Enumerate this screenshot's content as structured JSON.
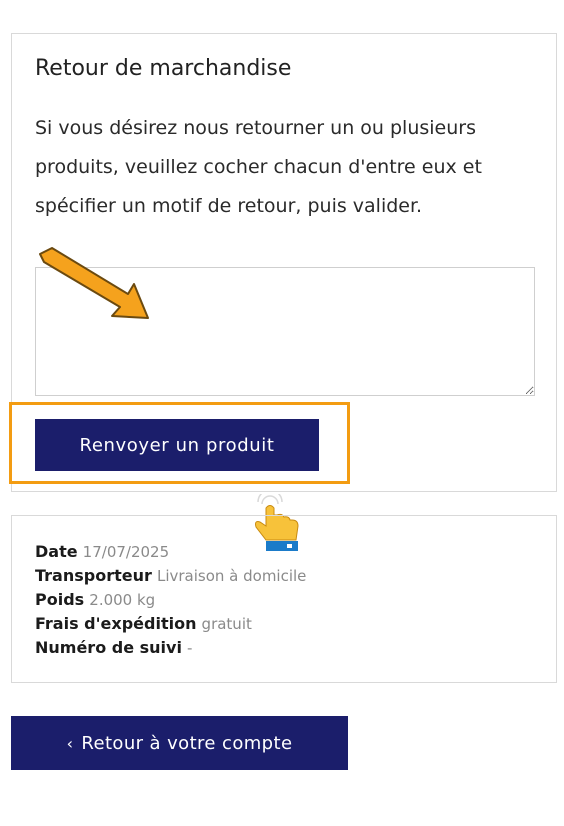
{
  "return_section": {
    "title": "Retour de marchandise",
    "description": "Si vous désirez nous retourner un ou plusieurs produits, veuillez cocher chacun d'entre eux et spécifier un motif de retour, puis valider.",
    "reason_textarea": {
      "value": "",
      "placeholder": ""
    },
    "submit_label": "Renvoyer un produit"
  },
  "annotations": {
    "arrow_icon": "arrow-pointing-down-right",
    "hand_icon": "pointing-hand-click",
    "highlight_color": "#f39c12"
  },
  "shipping_details": {
    "items": [
      {
        "label": "Date",
        "value": "17/07/2025"
      },
      {
        "label": "Transporteur",
        "value": "Livraison à domicile"
      },
      {
        "label": "Poids",
        "value": "2.000 kg"
      },
      {
        "label": "Frais d'expédition",
        "value": "gratuit"
      },
      {
        "label": "Numéro de suivi",
        "value": "-"
      }
    ]
  },
  "navigation": {
    "back_icon": "chevron-left",
    "back_label": "Retour à votre compte"
  },
  "colors": {
    "primary_button": "#1b1e6b",
    "border": "#d9d9d9",
    "muted_text": "#8a8a8a"
  }
}
